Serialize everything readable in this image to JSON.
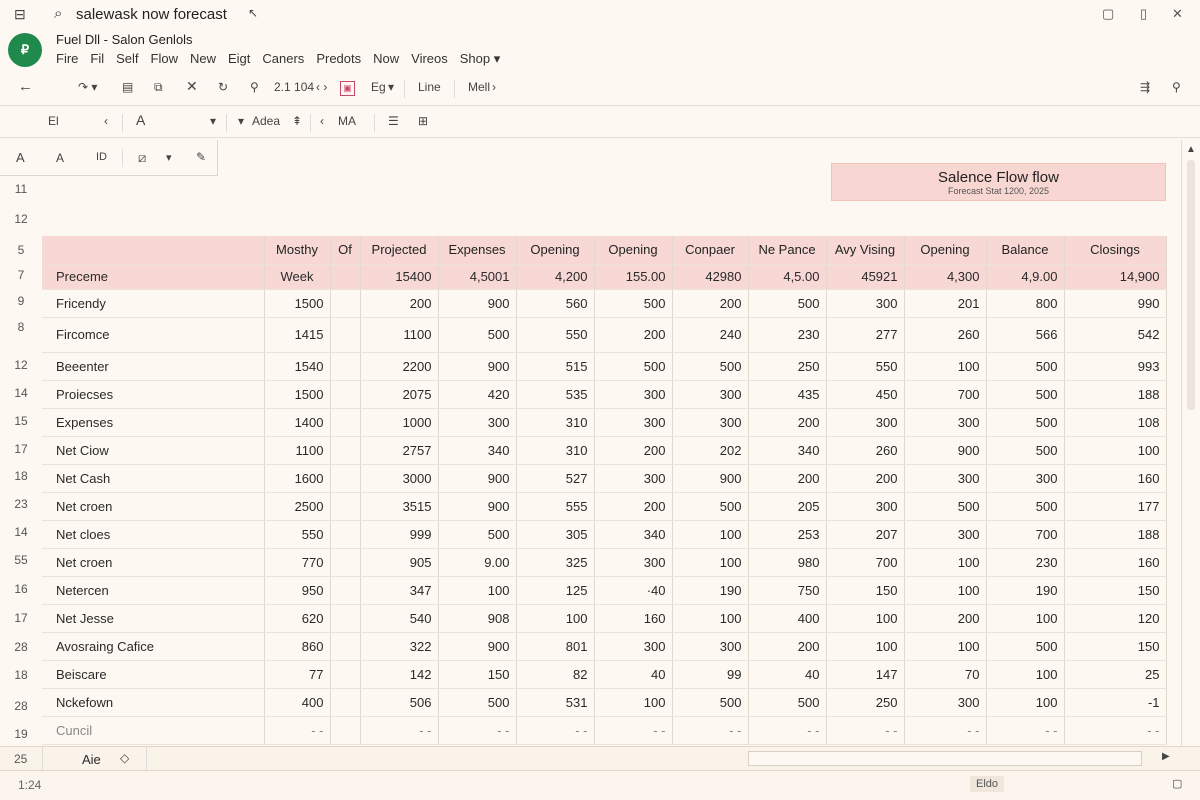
{
  "window": {
    "search_text": "salewask now forecast",
    "doc_title": "Fuel Dll - Salon Genlols"
  },
  "menu": [
    "Fire",
    "Fil",
    "Self",
    "Flow",
    "New",
    "Eigt",
    "Caners",
    "Predots",
    "Now",
    "Vireos",
    "Shop ▾"
  ],
  "toolbar1": {
    "font_size": "2.1 104",
    "zoom": "Eg",
    "line_btn": "Line",
    "mell_btn": "Mell"
  },
  "toolbar2": {
    "cell_ref": "El",
    "font": "A",
    "adea": "Adea",
    "ma": "MA"
  },
  "banner": {
    "title": "Salence Flow flow",
    "subtitle": "Forecast Stat 1200, 2025"
  },
  "row_numbers": [
    "11",
    "12",
    "5",
    "7",
    "9",
    "8",
    "12",
    "14",
    "15",
    "17",
    "18",
    "23",
    "14",
    "55",
    "16",
    "17",
    "28",
    "18",
    "28",
    "19"
  ],
  "table": {
    "headers": [
      "",
      "Mosthy",
      "Of",
      "Projected",
      "Expenses",
      "Opening",
      "Opening",
      "Conpaer",
      "Ne Pance",
      "Avy Vising",
      "Opening",
      "Balance",
      "Closings"
    ],
    "subheader": [
      "Preceme",
      "Week",
      "",
      "15400",
      "4,5001",
      "4,200",
      "155.00",
      "42980",
      "4,5.00",
      "45921",
      "4,300",
      "4,9.00",
      "14,900"
    ],
    "rows": [
      [
        "Fricendy",
        "1500",
        "",
        "200",
        "900",
        "560",
        "500",
        "200",
        "500",
        "300",
        "201",
        "800",
        "990"
      ],
      [
        "Fircomce",
        "1415",
        "",
        "1100",
        "500",
        "550",
        "200",
        "240",
        "230",
        "277",
        "260",
        "566",
        "542"
      ],
      [
        "Beeenter",
        "1540",
        "",
        "2200",
        "900",
        "515",
        "500",
        "500",
        "250",
        "550",
        "100",
        "500",
        "993"
      ],
      [
        "Proiecses",
        "1500",
        "",
        "2075",
        "420",
        "535",
        "300",
        "300",
        "435",
        "450",
        "700",
        "500",
        "188"
      ],
      [
        "Expenses",
        "1400",
        "",
        "1000",
        "300",
        "310",
        "300",
        "300",
        "200",
        "300",
        "300",
        "500",
        "108"
      ],
      [
        "Net Ciow",
        "1100",
        "",
        "2757",
        "340",
        "310",
        "200",
        "202",
        "340",
        "260",
        "900",
        "500",
        "100"
      ],
      [
        "Net Cash",
        "1600",
        "",
        "3000",
        "900",
        "527",
        "300",
        "900",
        "200",
        "200",
        "300",
        "300",
        "160"
      ],
      [
        "Net croen",
        "2500",
        "",
        "3515",
        "900",
        "555",
        "200",
        "500",
        "205",
        "300",
        "500",
        "500",
        "177"
      ],
      [
        "Net cloes",
        "550",
        "",
        "999",
        "500",
        "305",
        "340",
        "100",
        "253",
        "207",
        "300",
        "700",
        "188"
      ],
      [
        "Net croen",
        "770",
        "",
        "905",
        "9.00",
        "325",
        "300",
        "100",
        "980",
        "700",
        "100",
        "230",
        "160"
      ],
      [
        "Netercen",
        "950",
        "",
        "347",
        "100",
        "125",
        "·40",
        "190",
        "750",
        "150",
        "100",
        "190",
        "150"
      ],
      [
        "Net Jesse",
        "620",
        "",
        "540",
        "908",
        "100",
        "160",
        "100",
        "400",
        "100",
        "200",
        "100",
        "120"
      ],
      [
        "Avosraing Cafice",
        "860",
        "",
        "322",
        "900",
        "801",
        "300",
        "300",
        "200",
        "100",
        "100",
        "500",
        "150"
      ],
      [
        "Beiscare",
        "77",
        "",
        "142",
        "150",
        "82",
        "40",
        "99",
        "40",
        "147",
        "70",
        "100",
        "25"
      ],
      [
        "Nckefown",
        "400",
        "",
        "506",
        "500",
        "531",
        "100",
        "500",
        "500",
        "250",
        "300",
        "100",
        "-1"
      ],
      [
        "Cuncil",
        "- -",
        "",
        "- -",
        "- -",
        "- -",
        "- -",
        "- -",
        "- -",
        "- -",
        "- -",
        "- -",
        "- -"
      ]
    ]
  },
  "sheetbar": {
    "row_label": "25",
    "tab_label": "Aie"
  },
  "status": {
    "left": "1:24",
    "right": "Eldo"
  }
}
